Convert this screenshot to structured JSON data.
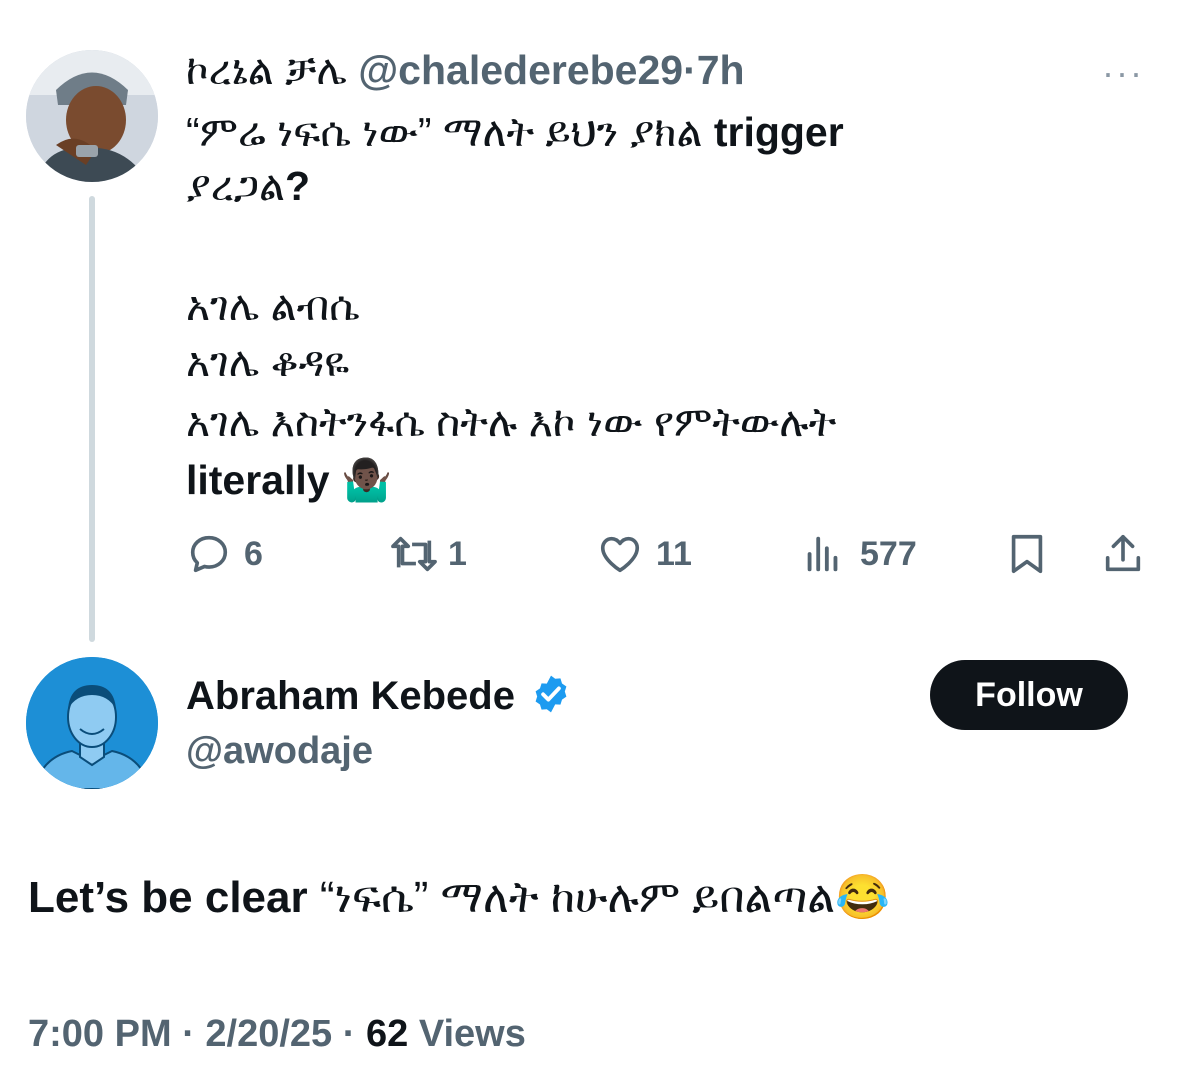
{
  "parent": {
    "display_name": "ኮረኔል ቻሌ",
    "handle": "@chalederebe29",
    "separator": "·",
    "time": "7h",
    "more": "···",
    "lines": {
      "l1_prefix": "“ምሬ ነፍሴ ነው” ማለት ይህን ያክል ",
      "l1_bold": "trigger",
      "l2_prefix": "ያረጋል",
      "l2_bold": "?",
      "l3": "አገሌ ልብሴ",
      "l4": "አገሌ ቆዳዬ",
      "l5": "አገሌ እስትንፋሴ ስትሉ እኮ ነው የምትውሉት",
      "l6_bold": "literally",
      "l6_emoji": "🤷🏿‍♂️"
    },
    "actions": {
      "replies": "6",
      "reposts": "1",
      "likes": "11",
      "views": "577"
    }
  },
  "reply": {
    "display_name": "Abraham Kebede",
    "handle": "@awodaje",
    "follow_label": "Follow",
    "text_bold": "Let’s be clear ",
    "text_rest": "“ነፍሴ” ማለት ከሁሉም ይበልጣል",
    "emoji": "😂",
    "time": "7:00 PM",
    "sep1": "·",
    "date": "2/20/25",
    "sep2": "·",
    "views_count": "62",
    "views_label": "Views"
  },
  "colors": {
    "text": "#0f1419",
    "muted": "#536471",
    "verified": "#1d9bf0",
    "thread_line": "#cfd9de"
  },
  "icons": [
    "reply-icon",
    "repost-icon",
    "like-icon",
    "views-icon",
    "bookmark-icon",
    "share-icon",
    "verified-badge-icon",
    "more-icon"
  ]
}
